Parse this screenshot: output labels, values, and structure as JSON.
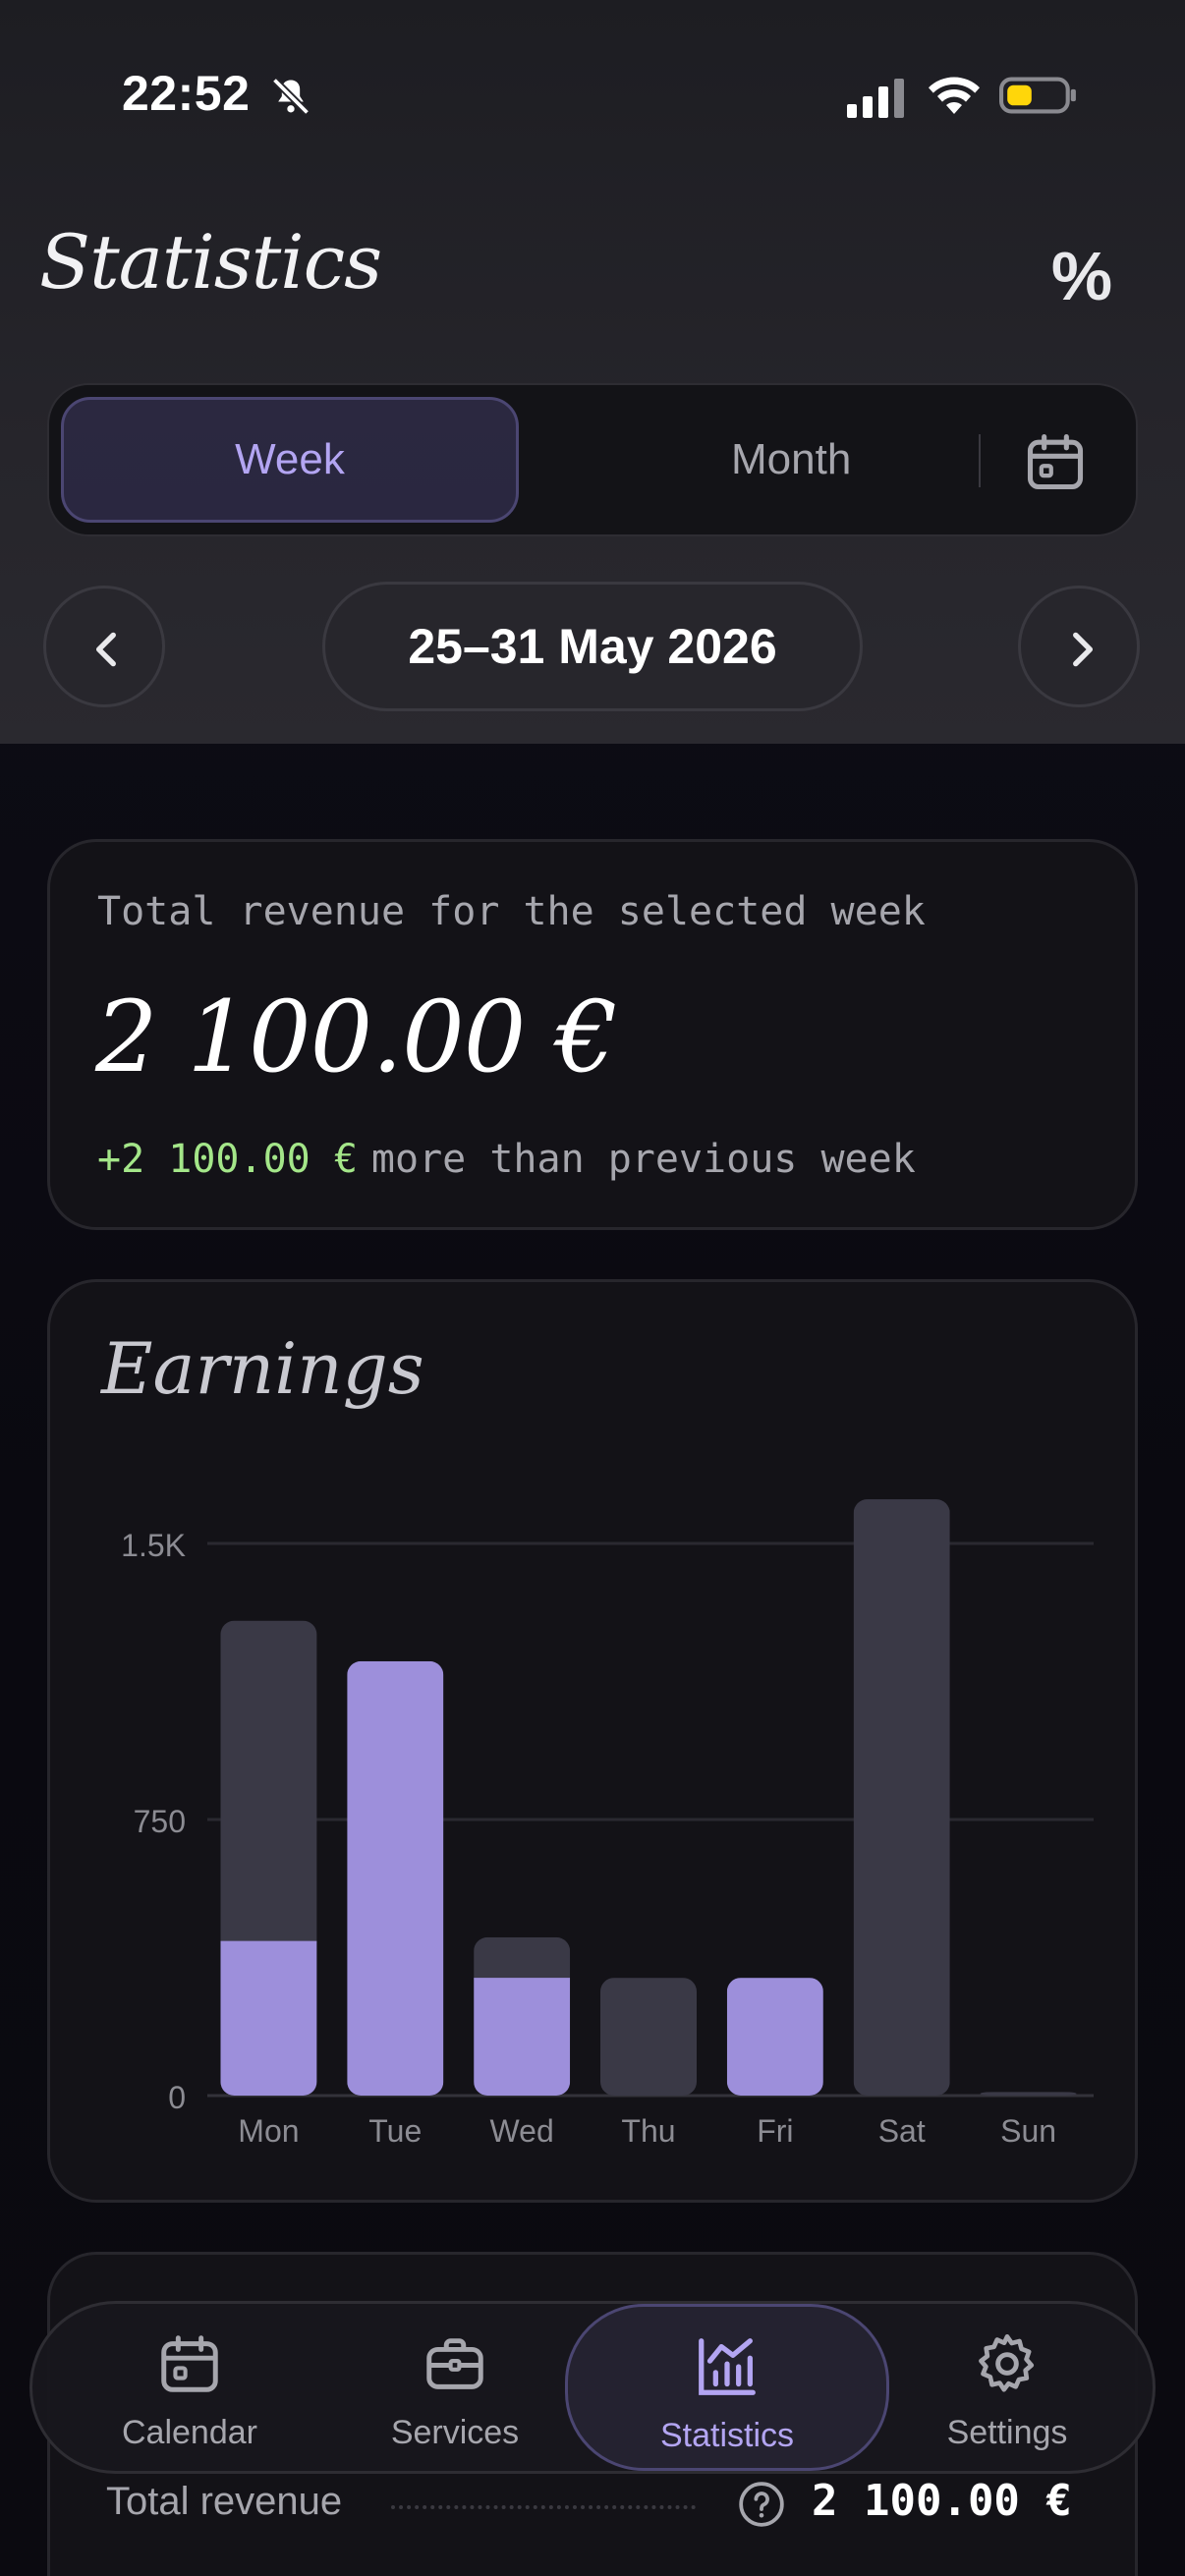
{
  "status_bar": {
    "time": "22:52"
  },
  "header": {
    "title": "Statistics",
    "percent_label": "%"
  },
  "period_toggle": {
    "week_label": "Week",
    "month_label": "Month",
    "selected": "Week"
  },
  "week_nav": {
    "range_label": "25–31 May 2026"
  },
  "revenue_card": {
    "label": "Total revenue for the selected week",
    "amount": "2 100.00 €",
    "delta_value": "+2 100.00 €",
    "delta_text": "more than previous week"
  },
  "earnings_card": {
    "title": "Earnings"
  },
  "chart_data": {
    "type": "bar",
    "stacked": true,
    "categories": [
      "Mon",
      "Tue",
      "Wed",
      "Thu",
      "Fri",
      "Sat",
      "Sun"
    ],
    "y_ticks": [
      "1.5K",
      "750",
      "0"
    ],
    "ylim": [
      0,
      1500
    ],
    "grid": true,
    "series": [
      {
        "values": [
          420,
          1180,
          320,
          0,
          320,
          0,
          0
        ],
        "color": "#9d8fdb"
      },
      {
        "values": [
          870,
          0,
          110,
          320,
          0,
          1620,
          10
        ],
        "color": "#3a3946"
      }
    ]
  },
  "summary_card": {
    "total_label": "Total revenue",
    "total_value": "2 100.00 €"
  },
  "tab_bar": {
    "items": [
      {
        "label": "Calendar",
        "icon": "calendar-icon"
      },
      {
        "label": "Services",
        "icon": "briefcase-icon"
      },
      {
        "label": "Statistics",
        "icon": "chart-icon"
      },
      {
        "label": "Settings",
        "icon": "gear-icon"
      }
    ],
    "active": "Statistics"
  },
  "colors": {
    "accent": "#b3a5f2",
    "bar_primary": "#9d8fdb",
    "bar_secondary": "#3a3946",
    "positive": "#a4e689"
  }
}
